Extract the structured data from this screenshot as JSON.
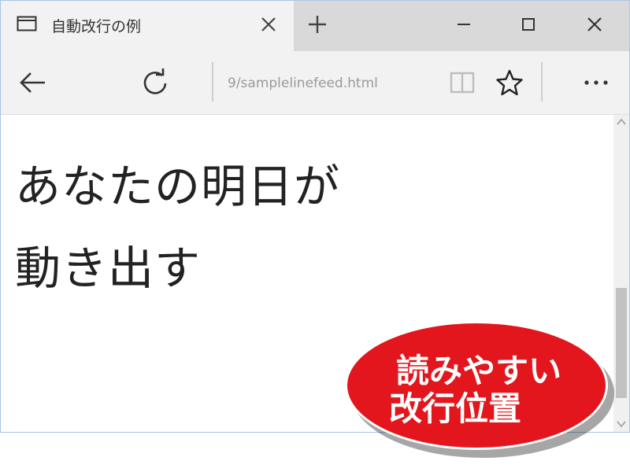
{
  "tab": {
    "title": "自動改行の例",
    "icon": "tab-page-icon",
    "close_icon": "close-icon"
  },
  "new_tab_icon": "plus-icon",
  "window_controls": {
    "minimize_icon": "minimize-icon",
    "maximize_icon": "maximize-icon",
    "close_icon": "close-icon"
  },
  "toolbar": {
    "back_icon": "back-arrow-icon",
    "refresh_icon": "refresh-icon",
    "address": "9/samplelinefeed.html",
    "reading_view_icon": "reading-view-icon",
    "favorite_icon": "star-icon",
    "more_icon": "more-icon"
  },
  "content": {
    "line1": "あなたの明日が",
    "line2": "動き出す"
  },
  "badge": {
    "line1": "読みやすい",
    "line2": "改行位置",
    "color": "#e3161d"
  },
  "colors": {
    "titlebar": "#d9d9d9",
    "active_tab": "#f2f2f2",
    "window_border": "#a9c4e2"
  }
}
